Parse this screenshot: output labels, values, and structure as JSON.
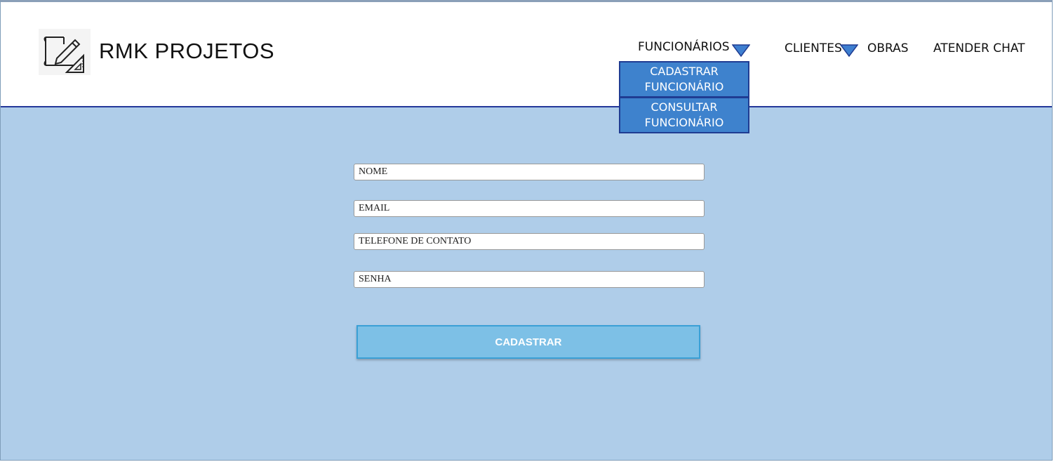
{
  "brand": {
    "name": "RMK PROJETOS",
    "logo_icon": "blueprint-pencil-icon"
  },
  "nav": {
    "funcionarios": "FUNCIONÁRIOS",
    "clientes": "CLIENTES",
    "obras": "OBRAS",
    "atender_chat": "ATENDER CHAT"
  },
  "dropdown": {
    "cadastrar_line1": "CADASTRAR",
    "cadastrar_line2": "FUNCIONÁRIO",
    "consultar_line1": "CONSULTAR",
    "consultar_line2": "FUNCIONÁRIO"
  },
  "form": {
    "nome_placeholder": "NOME",
    "email_placeholder": "EMAIL",
    "telefone_placeholder": "TELEFONE DE CONTATO",
    "senha_placeholder": "SENHA",
    "submit_label": "CADASTRAR"
  },
  "colors": {
    "header_border": "#24389a",
    "page_bg": "#afcde9",
    "dropdown_bg": "#3e82cd",
    "button_bg": "#7dc0e6",
    "caret": "#3e7fd0"
  }
}
